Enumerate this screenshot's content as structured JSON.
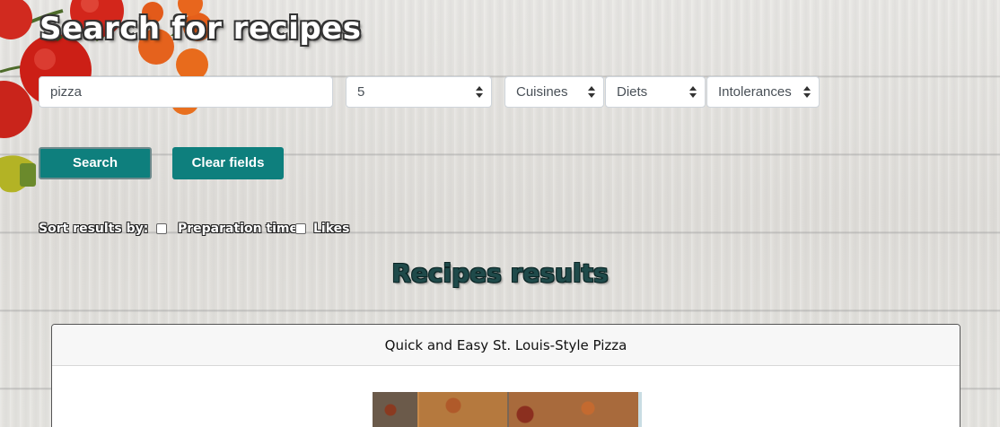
{
  "page": {
    "title": "Search for recipes"
  },
  "search": {
    "query": "pizza",
    "count_value": "5",
    "cuisines_label": "Cuisines",
    "diets_label": "Diets",
    "intolerances_label": "Intolerances"
  },
  "buttons": {
    "search_label": "Search",
    "clear_label": "Clear fields"
  },
  "sort": {
    "label": "Sort results by:",
    "option_time": "Preparation time",
    "option_likes": "Likes"
  },
  "results": {
    "title": "Recipes results",
    "cards": [
      {
        "title": "Quick and Easy St. Louis-Style Pizza"
      }
    ]
  },
  "colors": {
    "button_bg": "#0e7f7d",
    "results_title": "#1f4a4a"
  },
  "icons": {
    "select_arrow": "updown-caret-icon"
  }
}
